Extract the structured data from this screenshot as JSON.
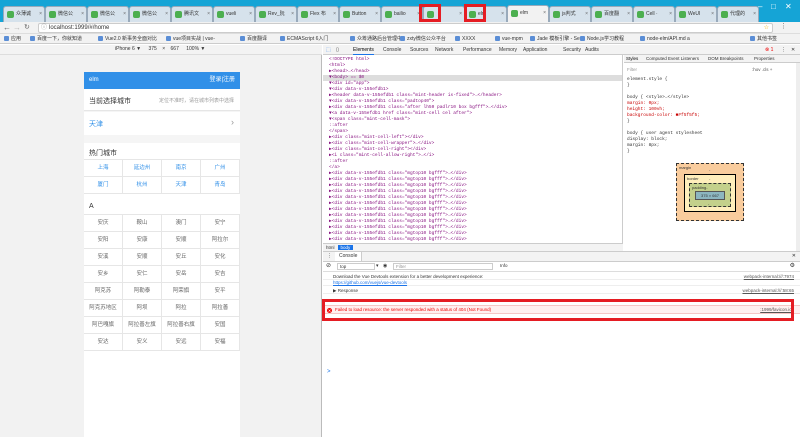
{
  "tabs": [
    {
      "label": "众薄诚"
    },
    {
      "label": "微信公"
    },
    {
      "label": "微信公"
    },
    {
      "label": "微信公"
    },
    {
      "label": "腾讯文"
    },
    {
      "label": "vueli"
    },
    {
      "label": "Rev_阮"
    },
    {
      "label": "Flex 布"
    },
    {
      "label": "Button"
    },
    {
      "label": "bailio"
    },
    {
      "label": ""
    },
    {
      "label": "elm"
    },
    {
      "label": "elm"
    },
    {
      "label": "js判式"
    },
    {
      "label": "百度翻"
    },
    {
      "label": "Cell · "
    },
    {
      "label": "WeUI"
    },
    {
      "label": "代理的"
    }
  ],
  "address": {
    "url": "localhost:1999/#/home"
  },
  "bookmarks": [
    "应用",
    "百度一下，你就知道",
    "Vue2.0 新事务全面对比",
    "vue项目实战 | vue-",
    "百度翻译",
    "ECMAScript 6入门",
    "众筹通路后台管理中",
    "zxty微信公众平台",
    "XXXX",
    "vue-mpm",
    "Jade 模板引擎 - Se",
    "Node.js学习教程",
    "node-elm/API.md a",
    "其他书签"
  ],
  "device": {
    "label": "iPhone 6 ▼",
    "width": "375",
    "x": "×",
    "height": "667",
    "zoom": "100% ▼"
  },
  "phone": {
    "logo": "elm",
    "auth": "登录|注册",
    "current_label": "当前选择城市",
    "current_hint": "定位不准时，请在城市列表中选择",
    "current_city": "天津",
    "current_arrow": "›",
    "hot_title": "热门城市",
    "hot_cities": [
      "上海",
      "延边州",
      "南京",
      "广州",
      "厦门",
      "杭州",
      "天津",
      "青岛"
    ],
    "letter": "A",
    "a_cities": [
      "安庆",
      "鞍山",
      "澳门",
      "安宁",
      "安阳",
      "安康",
      "安顺",
      "阿拉尔",
      "安溪",
      "安顺",
      "安丘",
      "安化",
      "安乡",
      "安仁",
      "安岳",
      "安吉",
      "阿克苏",
      "阿勒泰",
      "阿荣旗",
      "安平",
      "阿克苏地区",
      "阿坝",
      "阿拉",
      "阿拉善",
      "阿巴嘎旗",
      "阿拉善左旗",
      "阿拉善右旗",
      "安国",
      "安达",
      "安义",
      "安远",
      "安福"
    ]
  },
  "devtools": {
    "tabs": [
      "Elements",
      "Console",
      "Sources",
      "Network",
      "Performance",
      "Memory",
      "Application",
      "Security",
      "Audits"
    ],
    "tree": [
      "<!DOCTYPE html>",
      "<html>",
      "  ▶<head>…</head>",
      "  ▼<body> == $0",
      "    ▼<div id=\"app\">",
      "      ▼<div data-v-155efdb1>",
      "        ▶<header data-v-155efdb1 class=\"mint-header is-fixed\">…</header>",
      "        ▼<div data-v-155efdb1 class=\"padtop40\">",
      "          ▶<div data-v-155efdb1 class=\"after lh50 padlr10 box bgfff\">…</div>",
      "          ▼<a data-v-155efdb1 href class=\"mint-cell cel after\">",
      "            ▼<span class=\"mint-cell-mask\">",
      "                ::after",
      "              </span>",
      "            ▶<div class=\"mint-cell-left\"></div>",
      "            ▶<div class=\"mint-cell-wrapper\">…</div>",
      "            ▶<div class=\"mint-cell-right\"></div>",
      "            ▶<i class=\"mint-cell-allow-right\">…</i>",
      "                ::after",
      "            </a>",
      "          ▶<div data-v-155efdb1 class=\"mgtop10 bgfff\">…</div>",
      "          ▶<div data-v-155efdb1 class=\"mgtop10 bgfff\">…</div>",
      "          ▶<div data-v-155efdb1 class=\"mgtop10 bgfff\">…</div>",
      "          ▶<div data-v-155efdb1 class=\"mgtop10 bgfff\">…</div>",
      "          ▶<div data-v-155efdb1 class=\"mgtop10 bgfff\">…</div>",
      "          ▶<div data-v-155efdb1 class=\"mgtop10 bgfff\">…</div>",
      "          ▶<div data-v-155efdb1 class=\"mgtop10 bgfff\">…</div>",
      "          ▶<div data-v-155efdb1 class=\"mgtop10 bgfff\">…</div>",
      "          ▶<div data-v-155efdb1 class=\"mgtop10 bgfff\">…</div>",
      "          ▶<div data-v-155efdb1 class=\"mgtop10 bgfff\">…</div>",
      "          ▶<div data-v-155efdb1 class=\"mgtop10 bgfff\">…</div>",
      "          ▶<div data-v-155efdb1 class=\"mgtop10 bgfff\">…</div>"
    ],
    "crumbs": [
      "html",
      "body"
    ],
    "style_tabs": [
      "Styles",
      "Computed",
      "Event Listeners",
      "DOM Breakpoints",
      "Properties"
    ],
    "filter": "Filter",
    "filter_right": ":hov .cls +",
    "style_lines": [
      "element.style {",
      "}",
      "body {                                   <style>…</style>",
      "  margin: 0px;",
      "  height: 100vh;",
      "  background-color: ■#f5f5f5;",
      "}",
      "body {                         user agent stylesheet",
      "  display: block;",
      "  margin: 8px;",
      "}"
    ],
    "box": {
      "margin": "margin",
      "margin_val": "-",
      "border": "border",
      "border_val": "-",
      "padding": "padding-",
      "content": "375 × 667",
      "dash": "-"
    }
  },
  "console": {
    "tab": "Console",
    "context": "top",
    "filter_placeholder": "Filter",
    "level": "Info",
    "messages": [
      {
        "text": "Download the Vue Devtools extension for a better development experience:",
        "src": "webpack-internal:///:7974"
      },
      {
        "text": "https://github.com/vuejs/vue-devtools",
        "src": ""
      },
      {
        "text": "▶ Response",
        "src": "webpack-internal:///:58:65"
      },
      {
        "text": "Failed to load resource: the server responded with a status of 404 (Not Found)",
        "src": ":1999/favicon.ico"
      }
    ],
    "prompt": ">"
  }
}
